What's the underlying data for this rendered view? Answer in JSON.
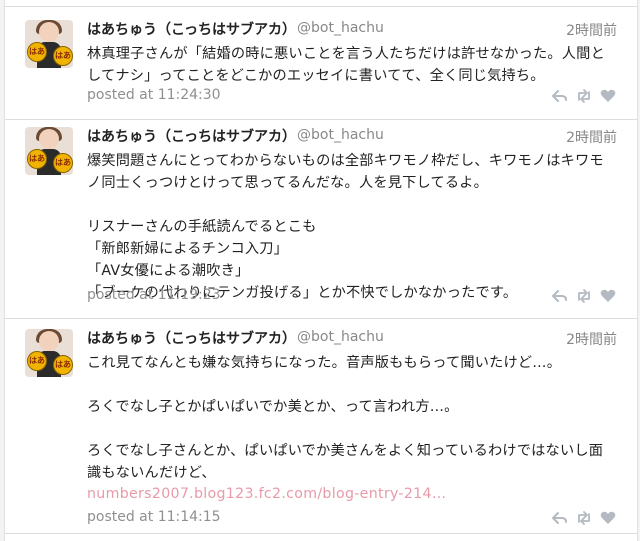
{
  "tweets": [
    {
      "name": "はあちゅう（こっちはサブアカ）",
      "handle": "@bot_hachu",
      "time": "2時間前",
      "text": "林真理子さんが「結婚の時に悪いことを言う人たちだけは許せなかった。人間としてナシ」ってことをどこかのエッセイに書いてて、全く同じ気持ち。",
      "posted": "posted at 11:24:30"
    },
    {
      "name": "はあちゅう（こっちはサブアカ）",
      "handle": "@bot_hachu",
      "time": "2時間前",
      "text": "爆笑問題さんにとってわからないものは全部キワモノ枠だし、キワモノはキワモノ同士くっつけとけって思ってるんだな。人を見下してるよ。\n\nリスナーさんの手紙読んでるとこも\n「新郎新婦によるチンコ入刀」\n「AV女優による潮吹き」\n「ブーケの代わりにテンガ投げる」とか不快でしかなかったです。",
      "posted": "posted at 11:19:23"
    },
    {
      "name": "はあちゅう（こっちはサブアカ）",
      "handle": "@bot_hachu",
      "time": "2時間前",
      "text": "これ見てなんとも嫌な気持ちになった。音声版ももらって聞いたけど…。\n\nろくでなし子とかぱいぱいでか美とか、って言われ方…。\n\nろくでなし子さんとか、ぱいぱいでか美さんをよく知っているわけではないし面識もないんだけど、",
      "link": "numbers2007.blog123.fc2.com/blog-entry-214…",
      "posted": "posted at 11:14:15"
    }
  ],
  "avatar_fan_text": "はあ",
  "icons": [
    "reply-icon",
    "retweet-icon",
    "favorite-icon"
  ],
  "colors": {
    "link": "#e89aa8",
    "muted": "#888888",
    "icon": "#b3bac1"
  }
}
